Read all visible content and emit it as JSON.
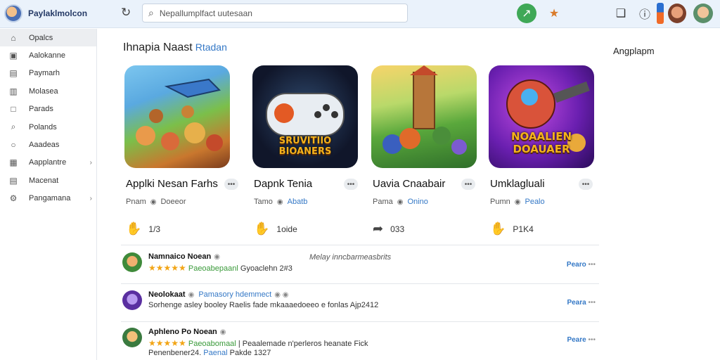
{
  "brand": {
    "name": "Paylaklmolcon"
  },
  "search": {
    "placeholder": "Nepallumplfact uutesaan"
  },
  "sidebar": {
    "items": [
      {
        "label": "Opalcs",
        "icon": "home-icon",
        "active": true
      },
      {
        "label": "Aalokanne",
        "icon": "window-icon"
      },
      {
        "label": "Paymarh",
        "icon": "bookmark-icon"
      },
      {
        "label": "Molasea",
        "icon": "box-icon"
      },
      {
        "label": "Parads",
        "icon": "square-icon"
      },
      {
        "label": "Polands",
        "icon": "search-icon"
      },
      {
        "label": "Aaadeas",
        "icon": "chat-icon"
      },
      {
        "label": "Aapplantre",
        "icon": "grid-icon",
        "chevron": true
      },
      {
        "label": "Macenat",
        "icon": "list-icon"
      },
      {
        "label": "Pangamana",
        "icon": "gear-icon",
        "chevron": true
      }
    ]
  },
  "main": {
    "section_title": "Ihnapia Naast",
    "section_sub": "Rtadan",
    "side_label": "Angplapm",
    "cards": [
      {
        "title": "Applki Nesan Farhs",
        "publisher": "Pnam",
        "dev": "Doeeor",
        "action_icon": "like-icon",
        "action_value": "1/3",
        "art_text": ""
      },
      {
        "title": "Dapnk Tenia",
        "publisher": "Tamo",
        "dev": "Abatb",
        "action_icon": "like-icon",
        "action_value": "1oide",
        "art_text": "SRUVITIIO BIOANERS"
      },
      {
        "title": "Uavia Cnaabair",
        "publisher": "Pama",
        "dev": "Onino",
        "action_icon": "share-icon",
        "action_value": "033",
        "art_text": ""
      },
      {
        "title": "Umklagluali",
        "publisher": "Pumn",
        "dev": "Pealo",
        "action_icon": "like-icon",
        "action_value": "P1K4",
        "art_text": "NOAALIEN DOAUAER"
      }
    ],
    "reviews": [
      {
        "name": "Namnaico Noean",
        "note": "Melay inncbarmeasbrits",
        "stars": "★★★★★",
        "green_text": "Paeoabepaanl",
        "text": "Gyoaclehn 2#3",
        "reply": "Pearo"
      },
      {
        "name": "Neolokaat",
        "tag": "Pamasory hdemmect",
        "stars": "",
        "text": "Sorhenge asley booley Raelis fade mkaaaedoeeo e fonlas  Ajp2412",
        "reply": "Peara"
      },
      {
        "name": "Aphleno Po Noean",
        "stars": "★★★★★",
        "green_text": "Paeoabomaal",
        "text": "| Peaalemade n'perleros heanate Fick",
        "line2_a": "Penenbener24.",
        "line2_blue": "Paenal",
        "line2_b": "Pakde 1327",
        "reply": "Peare"
      }
    ]
  }
}
